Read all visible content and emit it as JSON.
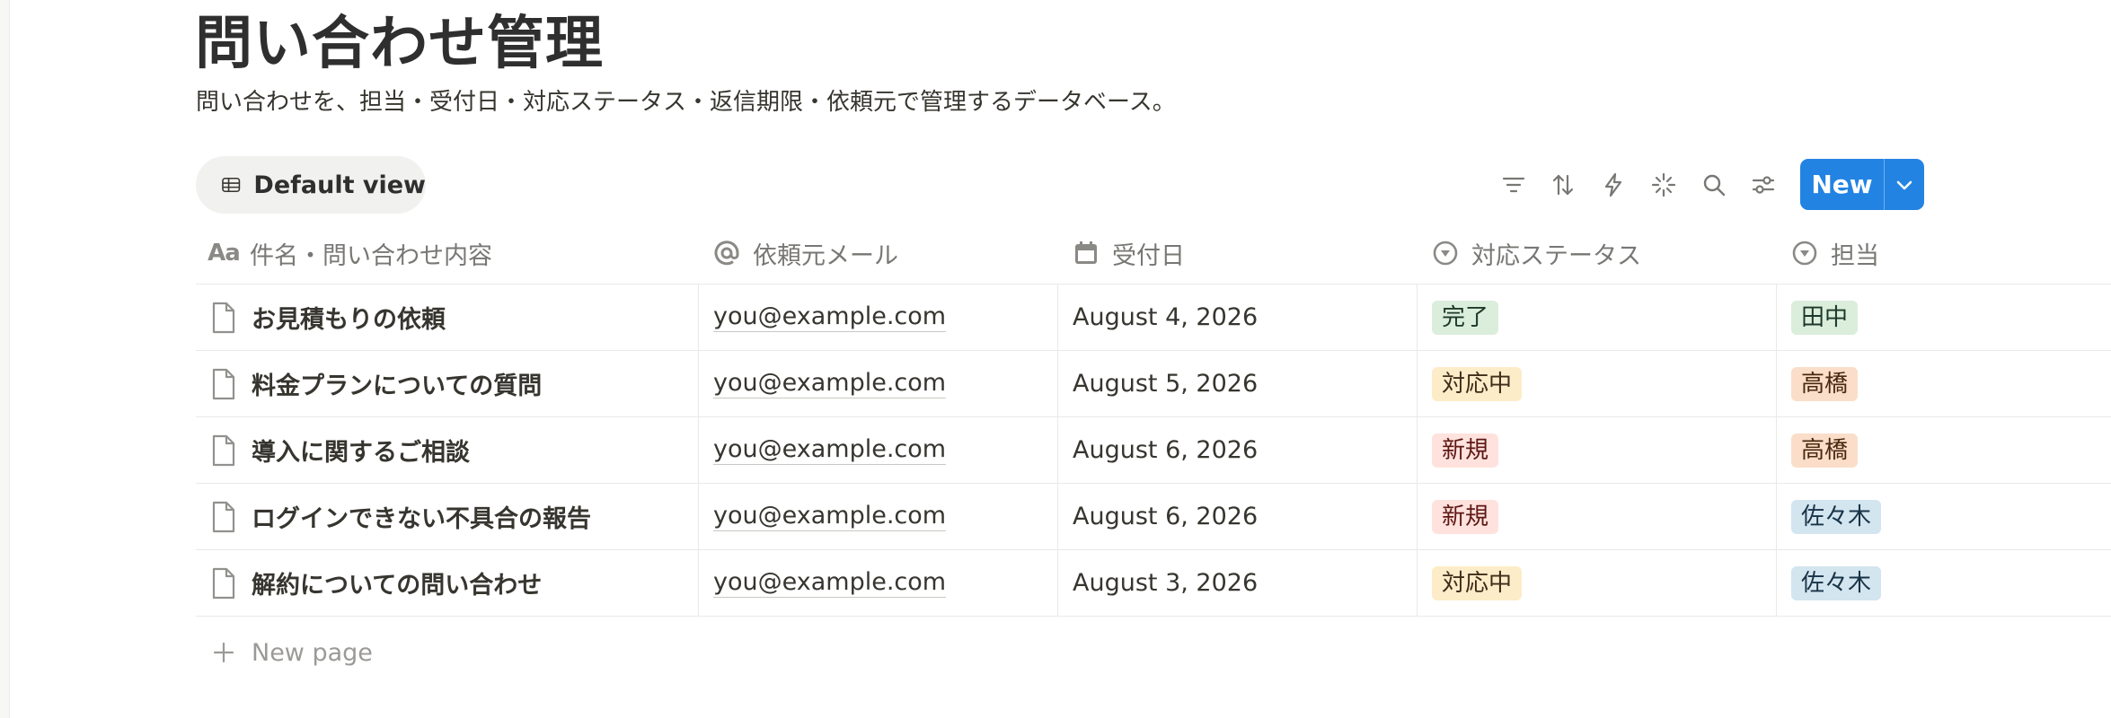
{
  "page": {
    "title": "問い合わせ管理",
    "description": "問い合わせを、担当・受付日・対応ステータス・返信期限・依頼元で管理するデータベース。"
  },
  "view": {
    "label": "Default view",
    "icon": "table-icon"
  },
  "toolbar": {
    "tools": [
      "filter-icon",
      "sort-icon",
      "automation-icon",
      "ai-sparkle-icon",
      "search-icon",
      "settings-sliders-icon"
    ],
    "new_label": "New",
    "accent": "#2383e2"
  },
  "columns": [
    {
      "label": "件名・問い合わせ内容",
      "icon": "title-aa-icon"
    },
    {
      "label": "依頼元メール",
      "icon": "at-sign-icon"
    },
    {
      "label": "受付日",
      "icon": "calendar-icon"
    },
    {
      "label": "対応ステータス",
      "icon": "status-select-icon"
    },
    {
      "label": "担当",
      "icon": "select-icon"
    }
  ],
  "rows": [
    {
      "title": "お見積もりの依頼",
      "email": "you@example.com",
      "date": "August 4, 2026",
      "status": "完了",
      "owner": "田中"
    },
    {
      "title": "料金プランについての質問",
      "email": "you@example.com",
      "date": "August 5, 2026",
      "status": "対応中",
      "owner": "高橋"
    },
    {
      "title": "導入に関するご相談",
      "email": "you@example.com",
      "date": "August 6, 2026",
      "status": "新規",
      "owner": "高橋"
    },
    {
      "title": "ログインできない不具合の報告",
      "email": "you@example.com",
      "date": "August 6, 2026",
      "status": "新規",
      "owner": "佐々木"
    },
    {
      "title": "解約についての問い合わせ",
      "email": "you@example.com",
      "date": "August 3, 2026",
      "status": "対応中",
      "owner": "佐々木"
    }
  ],
  "tag_colors": {
    "完了": {
      "bg": "#dbeddb",
      "fg": "#1c3829"
    },
    "対応中": {
      "bg": "#fdecc8",
      "fg": "#402c1b"
    },
    "新規": {
      "bg": "#ffe2dd",
      "fg": "#5d1715"
    },
    "田中": {
      "bg": "#dbeddb",
      "fg": "#1c3829"
    },
    "高橋": {
      "bg": "#fadec9",
      "fg": "#49290e"
    },
    "佐々木": {
      "bg": "#d3e5ef",
      "fg": "#183347"
    }
  },
  "new_page_label": "New page"
}
